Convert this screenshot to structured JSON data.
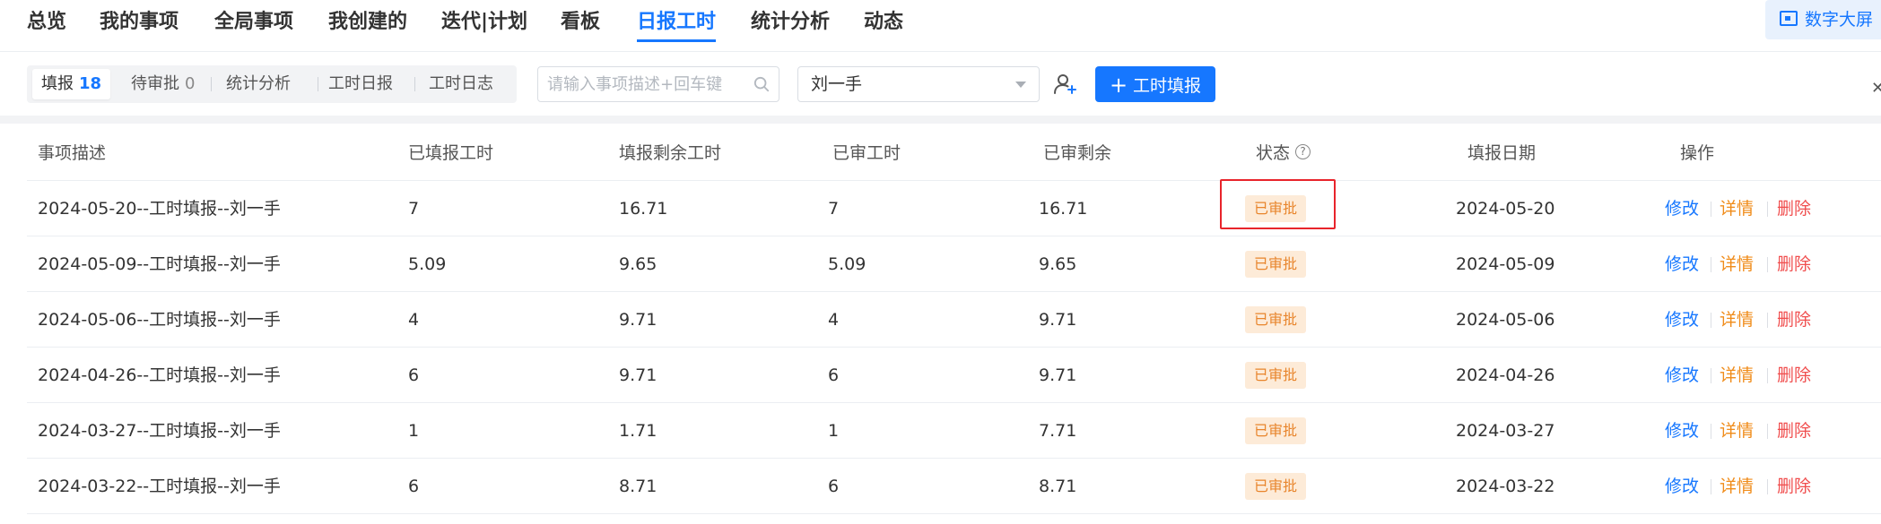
{
  "nav": {
    "items": [
      "总览",
      "我的事项",
      "全局事项",
      "我创建的",
      "迭代|计划",
      "看板",
      "日报工时",
      "统计分析",
      "动态"
    ],
    "active": "日报工时",
    "screen_button": "数字大屏"
  },
  "subtabs": [
    {
      "label": "填报",
      "count": "18"
    },
    {
      "label": "待审批",
      "count": "0"
    },
    {
      "label": "统计分析",
      "count": ""
    },
    {
      "label": "工时日报",
      "count": ""
    },
    {
      "label": "工时日志",
      "count": ""
    }
  ],
  "search": {
    "placeholder": "请输入事项描述+回车键",
    "value": ""
  },
  "user_select": {
    "value": "刘一手"
  },
  "fill_button": {
    "label": "工时填报"
  },
  "table": {
    "columns": [
      "事项描述",
      "已填报工时",
      "填报剩余工时",
      "已审工时",
      "已审剩余",
      "状态",
      "填报日期",
      "操作"
    ],
    "rows": [
      {
        "desc": "2024-05-20--工时填报--刘一手",
        "reported": "7",
        "remaining": "16.71",
        "approved": "7",
        "approved_remaining": "16.71",
        "status": "已审批",
        "date": "2024-05-20"
      },
      {
        "desc": "2024-05-09--工时填报--刘一手",
        "reported": "5.09",
        "remaining": "9.65",
        "approved": "5.09",
        "approved_remaining": "9.65",
        "status": "已审批",
        "date": "2024-05-09"
      },
      {
        "desc": "2024-05-06--工时填报--刘一手",
        "reported": "4",
        "remaining": "9.71",
        "approved": "4",
        "approved_remaining": "9.71",
        "status": "已审批",
        "date": "2024-05-06"
      },
      {
        "desc": "2024-04-26--工时填报--刘一手",
        "reported": "6",
        "remaining": "9.71",
        "approved": "6",
        "approved_remaining": "9.71",
        "status": "已审批",
        "date": "2024-04-26"
      },
      {
        "desc": "2024-03-27--工时填报--刘一手",
        "reported": "1",
        "remaining": "1.71",
        "approved": "1",
        "approved_remaining": "7.71",
        "status": "已审批",
        "date": "2024-03-27"
      },
      {
        "desc": "2024-03-22--工时填报--刘一手",
        "reported": "6",
        "remaining": "8.71",
        "approved": "6",
        "approved_remaining": "8.71",
        "status": "已审批",
        "date": "2024-03-22"
      }
    ],
    "actions": {
      "edit": "修改",
      "detail": "详情",
      "delete": "删除"
    }
  },
  "colors": {
    "accent": "#1677ff",
    "badge_bg": "#fdebd8",
    "badge_text": "#e8852c",
    "detail": "#f08c1a",
    "delete": "#f04d4d",
    "highlight": "#e8242b"
  },
  "icons": [
    "dashboard-icon",
    "search-icon",
    "chevron-down-icon",
    "add-user-icon",
    "plus-icon",
    "pin-icon",
    "help-icon"
  ]
}
